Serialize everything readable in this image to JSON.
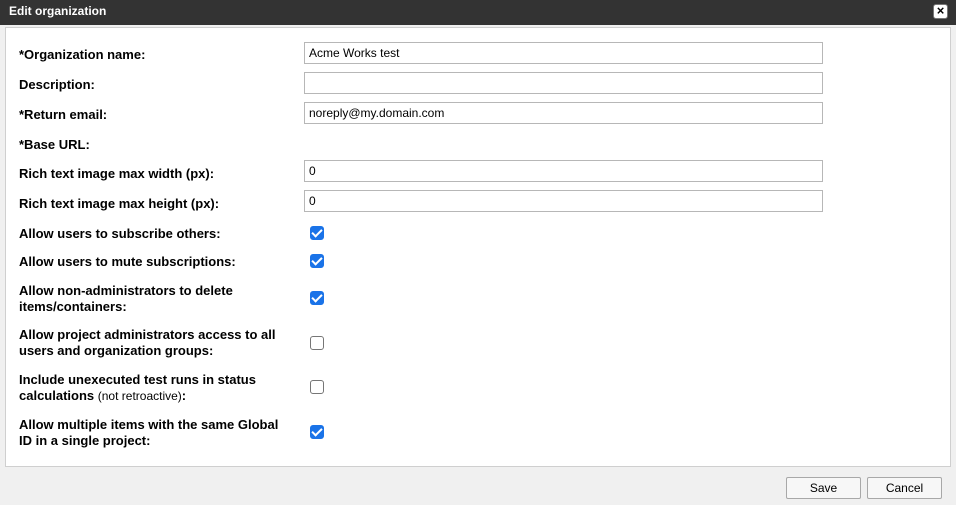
{
  "dialog": {
    "title": "Edit organization",
    "close_icon": "close-icon"
  },
  "form": {
    "org_name": {
      "label": "*Organization name:",
      "value": "Acme Works test"
    },
    "description": {
      "label": "Description:",
      "value": ""
    },
    "return_email": {
      "label": "*Return email:",
      "value": "noreply@my.domain.com"
    },
    "base_url": {
      "label": "*Base URL:"
    },
    "max_width": {
      "label": "Rich text image max width (px):",
      "value": "0"
    },
    "max_height": {
      "label": "Rich text image max height (px):",
      "value": "0"
    },
    "subscribe_others": {
      "label": "Allow users to subscribe others:",
      "checked": true
    },
    "mute_subscriptions": {
      "label": "Allow users to mute subscriptions:",
      "checked": true
    },
    "non_admin_delete": {
      "label_line1": "Allow non-administrators to delete",
      "label_line2": "items/containers:",
      "checked": true
    },
    "project_admin_access": {
      "label_line1": "Allow project administrators access to all",
      "label_line2": "users and organization groups:",
      "checked": false
    },
    "unexecuted_runs": {
      "label_line1": "Include unexecuted test runs in status",
      "label_line2": "calculations",
      "note": "(not retroactive)",
      "colon": ":",
      "checked": false
    },
    "multiple_global_id": {
      "label_line1": "Allow multiple items with the same Global",
      "label_line2": "ID in a single project:",
      "checked": true
    }
  },
  "footer": {
    "save_label": "Save",
    "cancel_label": "Cancel"
  },
  "colors": {
    "titlebar": "#333333",
    "checkbox_accent": "#1a73e8"
  }
}
